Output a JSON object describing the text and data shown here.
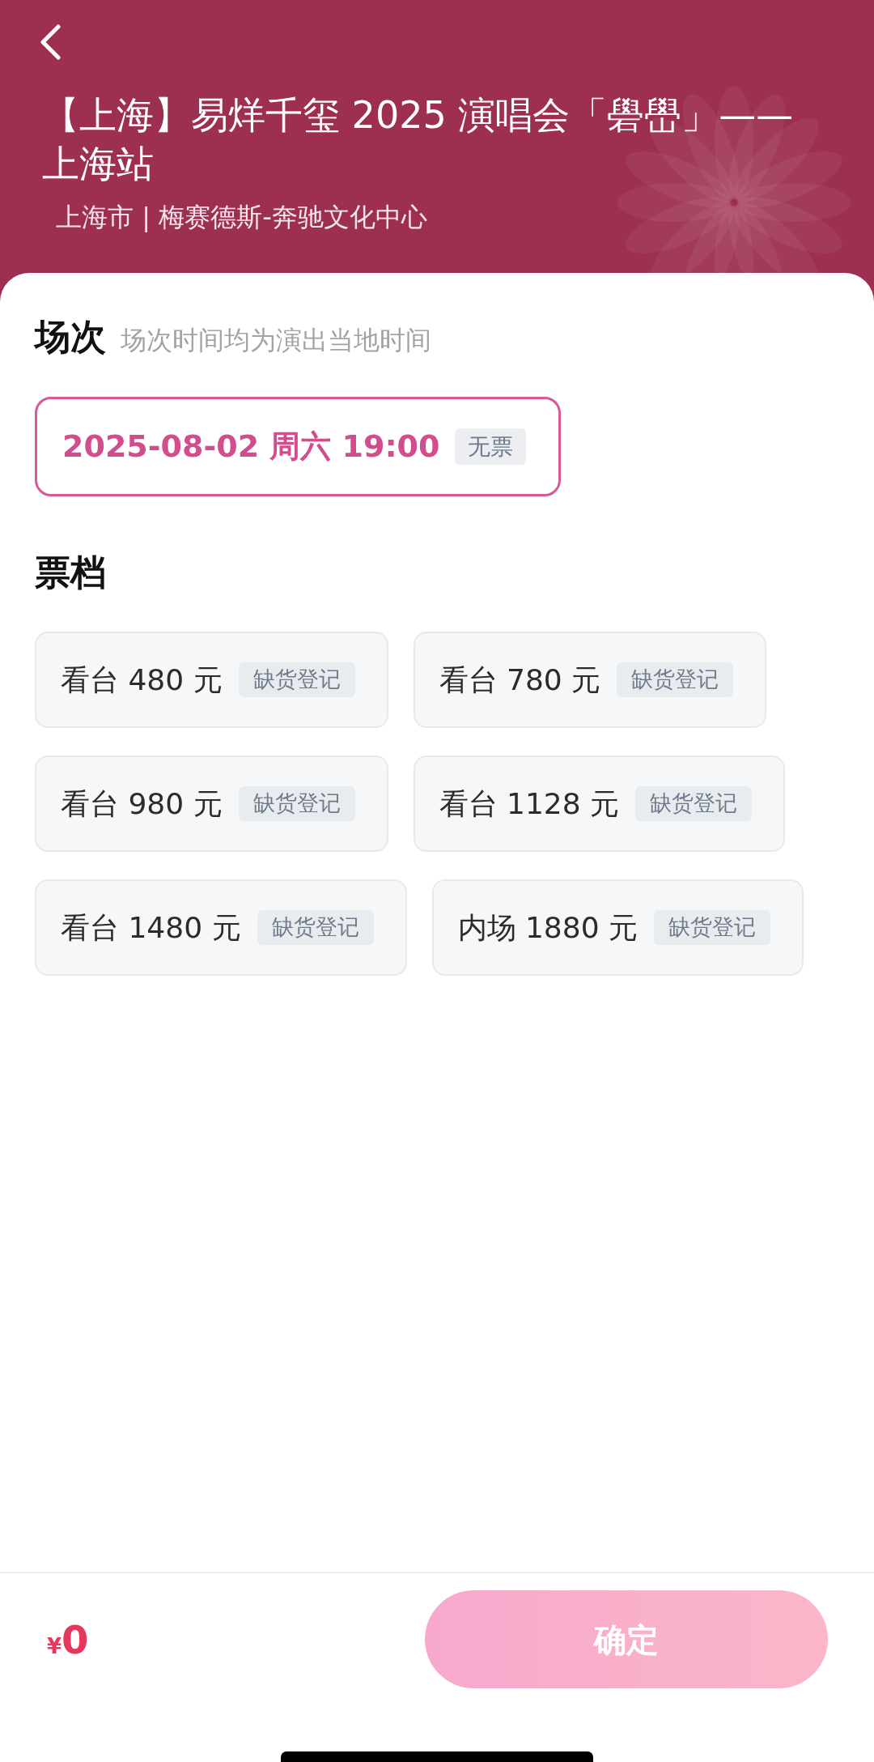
{
  "header": {
    "title": "【上海】易烊千玺 2025 演唱会「礐嶨」——上海站",
    "subtitle": "上海市 | 梅赛德斯-奔驰文化中心"
  },
  "sessions": {
    "title": "场次",
    "hint": "场次时间均为演出当地时间",
    "items": [
      {
        "label": "2025-08-02 周六 19:00",
        "badge": "无票",
        "selected": true
      }
    ]
  },
  "tickets": {
    "title": "票档",
    "items": [
      {
        "label": "看台 480 元",
        "badge": "缺货登记",
        "selected": false
      },
      {
        "label": "看台 780 元",
        "badge": "缺货登记",
        "selected": false
      },
      {
        "label": "看台 980 元",
        "badge": "缺货登记",
        "selected": false
      },
      {
        "label": "看台 1128 元",
        "badge": "缺货登记",
        "selected": false
      },
      {
        "label": "看台 1480 元",
        "badge": "缺货登记",
        "selected": false
      },
      {
        "label": "内场 1880 元",
        "badge": "缺货登记",
        "selected": false
      }
    ]
  },
  "footer": {
    "currency": "¥",
    "amount": "0",
    "confirm_button": {
      "label": "确定",
      "disabled": true
    }
  }
}
